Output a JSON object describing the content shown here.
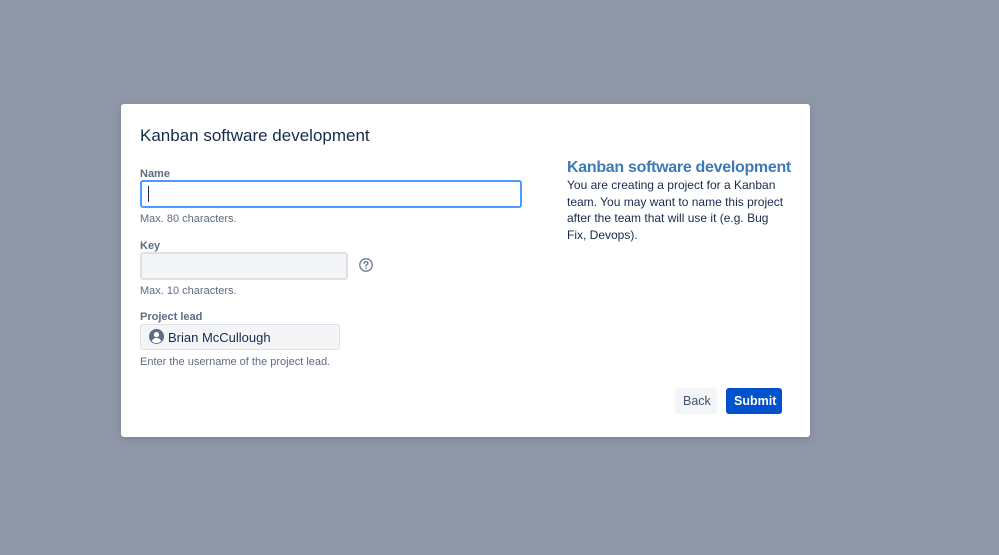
{
  "dialog": {
    "title": "Kanban software development",
    "fields": {
      "name": {
        "label": "Name",
        "value": "",
        "hint": "Max. 80 characters."
      },
      "key": {
        "label": "Key",
        "value": "",
        "hint": "Max. 10 characters."
      },
      "project_lead": {
        "label": "Project lead",
        "value": "Brian McCullough",
        "hint": "Enter the username of the project lead."
      }
    },
    "info": {
      "title": "Kanban software development",
      "body": "You are creating a project for a Kanban team. You may want to name this project after the team that will use it (e.g. Bug Fix, Devops)."
    },
    "buttons": {
      "back": "Back",
      "submit": "Submit"
    }
  },
  "icons": {
    "help": "help-circle-icon",
    "avatar": "user-avatar-icon"
  },
  "colors": {
    "backdrop": "#8e96a7",
    "primary": "#0052cc",
    "focus_border": "#4c9aff",
    "info_title": "#3d7ab8",
    "text": "#172b4d",
    "muted": "#5e6c84"
  }
}
